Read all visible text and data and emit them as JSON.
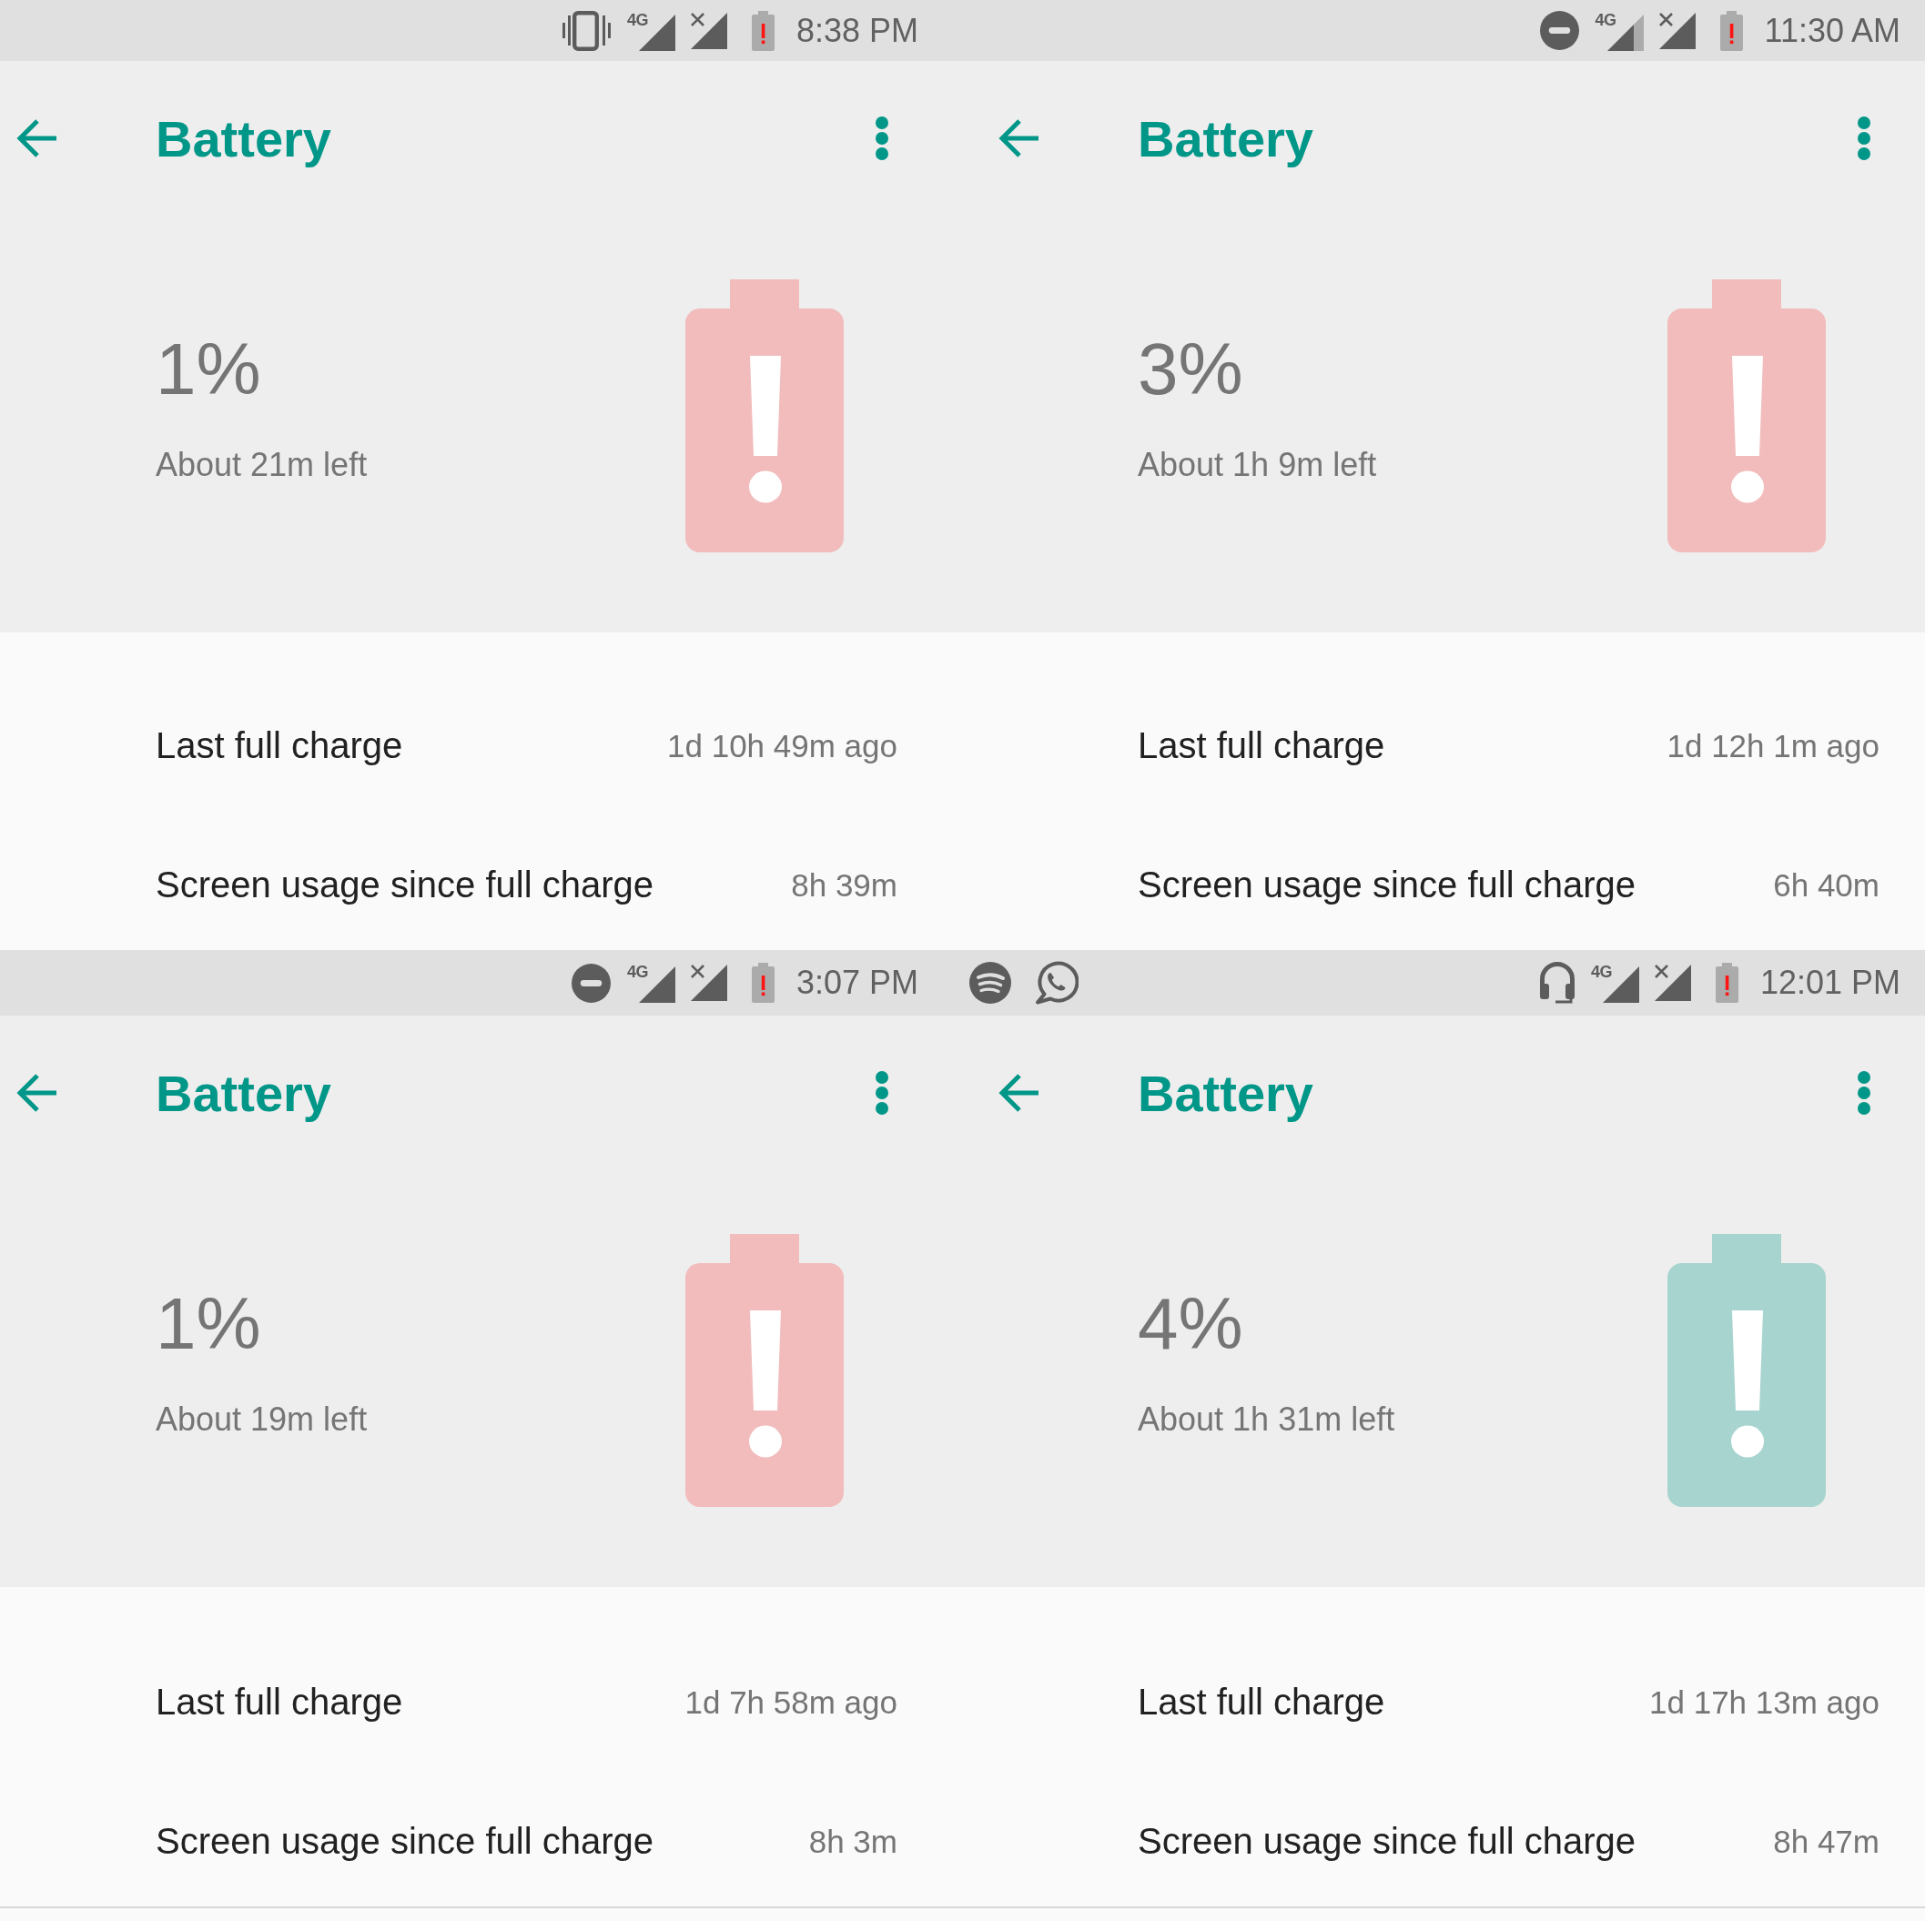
{
  "panels": [
    {
      "status_bar": {
        "icons": [
          {
            "kind": "vibrate"
          },
          {
            "kind": "signal",
            "label": "4G"
          },
          {
            "kind": "no-signal"
          },
          {
            "kind": "battery-alert"
          }
        ],
        "time": "8:38 PM"
      },
      "app_bar": {
        "title": "Battery"
      },
      "summary": {
        "percent": "1%",
        "remaining": "About 21m left",
        "battery": {
          "color": "#f2bcbc"
        }
      },
      "rows": [
        {
          "label": "Last full charge",
          "value": "1d 10h 49m ago"
        },
        {
          "label": "Screen usage since full charge",
          "value": "8h 39m"
        }
      ]
    },
    {
      "status_bar": {
        "icons": [
          {
            "kind": "dnd"
          },
          {
            "kind": "signal-weak",
            "label": "4G"
          },
          {
            "kind": "no-signal"
          },
          {
            "kind": "battery-alert"
          }
        ],
        "time": "11:30 AM"
      },
      "app_bar": {
        "title": "Battery"
      },
      "summary": {
        "percent": "3%",
        "remaining": "About 1h 9m left",
        "battery": {
          "color": "#f2bcbc"
        }
      },
      "rows": [
        {
          "label": "Last full charge",
          "value": "1d 12h 1m ago"
        },
        {
          "label": "Screen usage since full charge",
          "value": "6h 40m"
        }
      ]
    },
    {
      "status_bar": {
        "icons": [
          {
            "kind": "dnd"
          },
          {
            "kind": "signal",
            "label": "4G"
          },
          {
            "kind": "no-signal"
          },
          {
            "kind": "battery-alert"
          }
        ],
        "time": "3:07 PM"
      },
      "app_bar": {
        "title": "Battery"
      },
      "summary": {
        "percent": "1%",
        "remaining": "About 19m left",
        "battery": {
          "color": "#f2bcbc"
        }
      },
      "rows": [
        {
          "label": "Last full charge",
          "value": "1d 7h 58m ago"
        },
        {
          "label": "Screen usage since full charge",
          "value": "8h 3m"
        }
      ]
    },
    {
      "status_bar": {
        "notification_icons": [
          {
            "kind": "music"
          },
          {
            "kind": "chat"
          }
        ],
        "icons": [
          {
            "kind": "headset"
          },
          {
            "kind": "signal",
            "label": "4G"
          },
          {
            "kind": "no-signal"
          },
          {
            "kind": "battery-alert"
          }
        ],
        "time": "12:01 PM"
      },
      "app_bar": {
        "title": "Battery"
      },
      "summary": {
        "percent": "4%",
        "remaining": "About 1h 31m left",
        "battery": {
          "color": "#a8d4cf"
        }
      },
      "rows": [
        {
          "label": "Last full charge",
          "value": "1d 17h 13m ago"
        },
        {
          "label": "Screen usage since full charge",
          "value": "8h 47m"
        }
      ]
    }
  ]
}
